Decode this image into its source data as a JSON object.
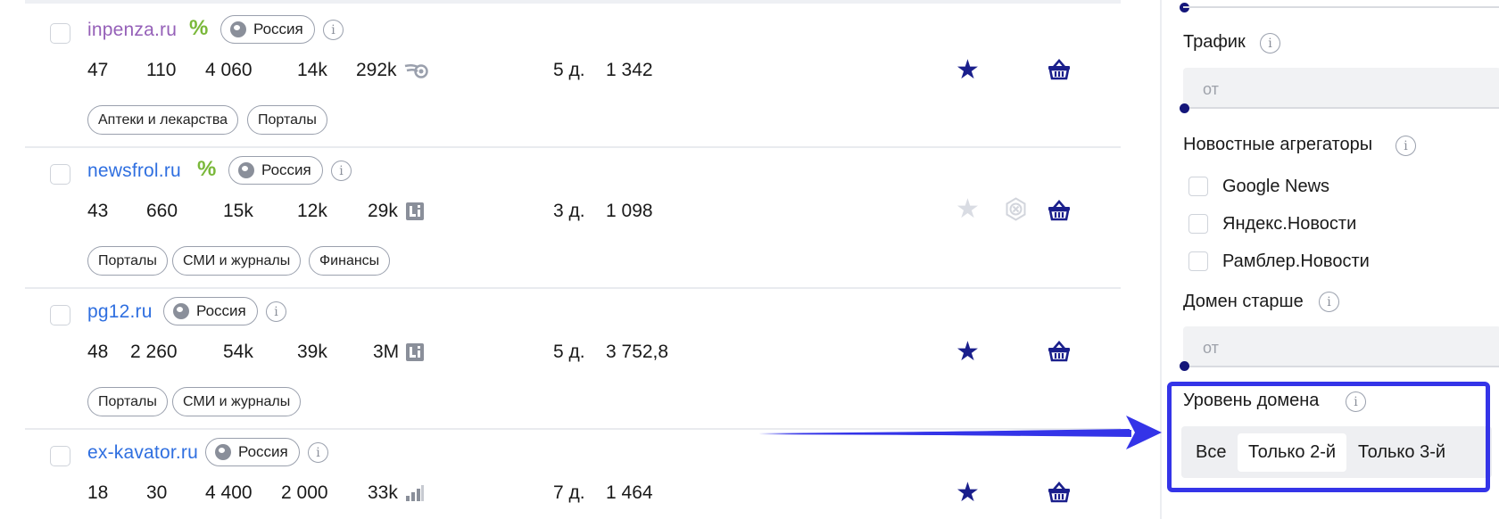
{
  "rows": [
    {
      "domain": "inpenza.ru",
      "region": "Россия",
      "metrics": [
        "47",
        "110",
        "4 060",
        "14k",
        "292k"
      ],
      "days": "5 д.",
      "price": "1 342",
      "tags": [
        "Аптеки и лекарства",
        "Порталы"
      ],
      "traffic_icon": "eye-flame-icon",
      "favorite": true
    },
    {
      "domain": "newsfrol.ru",
      "region": "Россия",
      "metrics": [
        "43",
        "660",
        "15k",
        "12k",
        "29k"
      ],
      "days": "3 д.",
      "price": "1 098",
      "tags": [
        "Порталы",
        "СМИ и журналы",
        "Финансы"
      ],
      "traffic_icon": "liveinternet-icon",
      "favorite": false
    },
    {
      "domain": "pg12.ru",
      "region": "Россия",
      "metrics": [
        "48",
        "2 260",
        "54k",
        "39k",
        "3M"
      ],
      "days": "5 д.",
      "price": "3 752,8",
      "tags": [
        "Порталы",
        "СМИ и журналы"
      ],
      "traffic_icon": "liveinternet-icon",
      "favorite": true
    },
    {
      "domain": "ex-kavator.ru",
      "region": "Россия",
      "metrics": [
        "18",
        "30",
        "4 400",
        "2 000",
        "33k"
      ],
      "days": "7 д.",
      "price": "1 464",
      "tags": [],
      "traffic_icon": "bar-chart-icon",
      "favorite": true
    }
  ],
  "sidebar": {
    "traffic_label": "Трафик",
    "traffic_placeholder": "от",
    "aggregators_label": "Новостные агрегаторы",
    "aggregators": [
      "Google News",
      "Яндекс.Новости",
      "Рамблер.Новости"
    ],
    "domain_age_label": "Домен старше",
    "domain_age_placeholder": "от",
    "domain_level_label": "Уровень домена",
    "domain_level_options": [
      "Все",
      "Только 2-й",
      "Только 3-й"
    ],
    "domain_level_selected": "Только 2-й"
  },
  "colors": {
    "accent": "#1a1f8c",
    "link": "#2f6fe0",
    "visited": "#9560b8",
    "highlight": "#3434e8",
    "percent": "#7ab83a"
  }
}
